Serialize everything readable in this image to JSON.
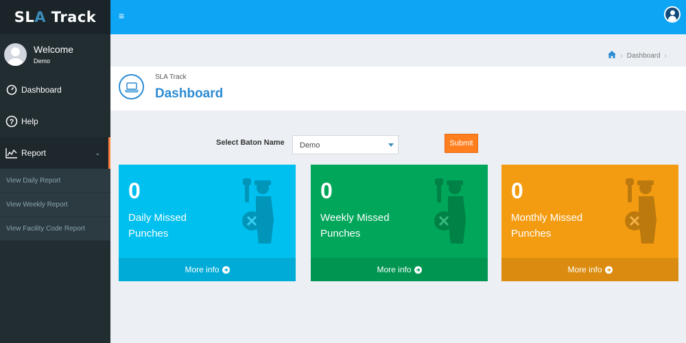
{
  "app": {
    "logo_main": "SL",
    "logo_accent": "A",
    "logo_tail": " Track"
  },
  "user": {
    "welcome": "Welcome",
    "name": "Demo"
  },
  "sidebar": {
    "items": [
      {
        "label": "Dashboard",
        "icon": "dashboard-gauge-icon"
      },
      {
        "label": "Help",
        "icon": "question-circle-icon"
      },
      {
        "label": "Report",
        "icon": "line-chart-icon",
        "active": true
      }
    ],
    "subitems": [
      {
        "label": "View Daily Report"
      },
      {
        "label": "View Weekly Report"
      },
      {
        "label": "View Facility Code Report"
      }
    ]
  },
  "header": {
    "menu_icon": "≡"
  },
  "breadcrumb": {
    "current": "Dashboard"
  },
  "page": {
    "subtitle": "SLA Track",
    "title": "Dashboard"
  },
  "form": {
    "label": "Select Baton Name",
    "selected": "Demo",
    "submit": "Submit"
  },
  "boxes": [
    {
      "count": "0",
      "label": "Daily Missed Punches",
      "footer": "More info",
      "color": "#00c0ef"
    },
    {
      "count": "0",
      "label": "Weekly Missed Punches",
      "footer": "More info",
      "color": "#00a65a"
    },
    {
      "count": "0",
      "label": "Monthly Missed Punches",
      "footer": "More info",
      "color": "#f39c12"
    }
  ],
  "colors": {
    "primary": "#0ea5f5",
    "sidebar": "#222d32",
    "accent": "#ff7f1f",
    "title": "#2b8bd3"
  }
}
